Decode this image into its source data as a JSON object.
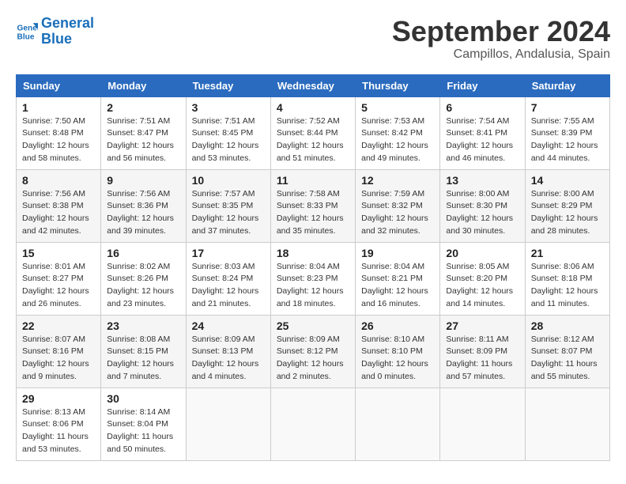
{
  "header": {
    "logo_line1": "General",
    "logo_line2": "Blue",
    "month": "September 2024",
    "location": "Campillos, Andalusia, Spain"
  },
  "weekdays": [
    "Sunday",
    "Monday",
    "Tuesday",
    "Wednesday",
    "Thursday",
    "Friday",
    "Saturday"
  ],
  "weeks": [
    [
      {
        "day": "1",
        "info": "Sunrise: 7:50 AM\nSunset: 8:48 PM\nDaylight: 12 hours\nand 58 minutes."
      },
      {
        "day": "2",
        "info": "Sunrise: 7:51 AM\nSunset: 8:47 PM\nDaylight: 12 hours\nand 56 minutes."
      },
      {
        "day": "3",
        "info": "Sunrise: 7:51 AM\nSunset: 8:45 PM\nDaylight: 12 hours\nand 53 minutes."
      },
      {
        "day": "4",
        "info": "Sunrise: 7:52 AM\nSunset: 8:44 PM\nDaylight: 12 hours\nand 51 minutes."
      },
      {
        "day": "5",
        "info": "Sunrise: 7:53 AM\nSunset: 8:42 PM\nDaylight: 12 hours\nand 49 minutes."
      },
      {
        "day": "6",
        "info": "Sunrise: 7:54 AM\nSunset: 8:41 PM\nDaylight: 12 hours\nand 46 minutes."
      },
      {
        "day": "7",
        "info": "Sunrise: 7:55 AM\nSunset: 8:39 PM\nDaylight: 12 hours\nand 44 minutes."
      }
    ],
    [
      {
        "day": "8",
        "info": "Sunrise: 7:56 AM\nSunset: 8:38 PM\nDaylight: 12 hours\nand 42 minutes."
      },
      {
        "day": "9",
        "info": "Sunrise: 7:56 AM\nSunset: 8:36 PM\nDaylight: 12 hours\nand 39 minutes."
      },
      {
        "day": "10",
        "info": "Sunrise: 7:57 AM\nSunset: 8:35 PM\nDaylight: 12 hours\nand 37 minutes."
      },
      {
        "day": "11",
        "info": "Sunrise: 7:58 AM\nSunset: 8:33 PM\nDaylight: 12 hours\nand 35 minutes."
      },
      {
        "day": "12",
        "info": "Sunrise: 7:59 AM\nSunset: 8:32 PM\nDaylight: 12 hours\nand 32 minutes."
      },
      {
        "day": "13",
        "info": "Sunrise: 8:00 AM\nSunset: 8:30 PM\nDaylight: 12 hours\nand 30 minutes."
      },
      {
        "day": "14",
        "info": "Sunrise: 8:00 AM\nSunset: 8:29 PM\nDaylight: 12 hours\nand 28 minutes."
      }
    ],
    [
      {
        "day": "15",
        "info": "Sunrise: 8:01 AM\nSunset: 8:27 PM\nDaylight: 12 hours\nand 26 minutes."
      },
      {
        "day": "16",
        "info": "Sunrise: 8:02 AM\nSunset: 8:26 PM\nDaylight: 12 hours\nand 23 minutes."
      },
      {
        "day": "17",
        "info": "Sunrise: 8:03 AM\nSunset: 8:24 PM\nDaylight: 12 hours\nand 21 minutes."
      },
      {
        "day": "18",
        "info": "Sunrise: 8:04 AM\nSunset: 8:23 PM\nDaylight: 12 hours\nand 18 minutes."
      },
      {
        "day": "19",
        "info": "Sunrise: 8:04 AM\nSunset: 8:21 PM\nDaylight: 12 hours\nand 16 minutes."
      },
      {
        "day": "20",
        "info": "Sunrise: 8:05 AM\nSunset: 8:20 PM\nDaylight: 12 hours\nand 14 minutes."
      },
      {
        "day": "21",
        "info": "Sunrise: 8:06 AM\nSunset: 8:18 PM\nDaylight: 12 hours\nand 11 minutes."
      }
    ],
    [
      {
        "day": "22",
        "info": "Sunrise: 8:07 AM\nSunset: 8:16 PM\nDaylight: 12 hours\nand 9 minutes."
      },
      {
        "day": "23",
        "info": "Sunrise: 8:08 AM\nSunset: 8:15 PM\nDaylight: 12 hours\nand 7 minutes."
      },
      {
        "day": "24",
        "info": "Sunrise: 8:09 AM\nSunset: 8:13 PM\nDaylight: 12 hours\nand 4 minutes."
      },
      {
        "day": "25",
        "info": "Sunrise: 8:09 AM\nSunset: 8:12 PM\nDaylight: 12 hours\nand 2 minutes."
      },
      {
        "day": "26",
        "info": "Sunrise: 8:10 AM\nSunset: 8:10 PM\nDaylight: 12 hours\nand 0 minutes."
      },
      {
        "day": "27",
        "info": "Sunrise: 8:11 AM\nSunset: 8:09 PM\nDaylight: 11 hours\nand 57 minutes."
      },
      {
        "day": "28",
        "info": "Sunrise: 8:12 AM\nSunset: 8:07 PM\nDaylight: 11 hours\nand 55 minutes."
      }
    ],
    [
      {
        "day": "29",
        "info": "Sunrise: 8:13 AM\nSunset: 8:06 PM\nDaylight: 11 hours\nand 53 minutes."
      },
      {
        "day": "30",
        "info": "Sunrise: 8:14 AM\nSunset: 8:04 PM\nDaylight: 11 hours\nand 50 minutes."
      },
      null,
      null,
      null,
      null,
      null
    ]
  ]
}
